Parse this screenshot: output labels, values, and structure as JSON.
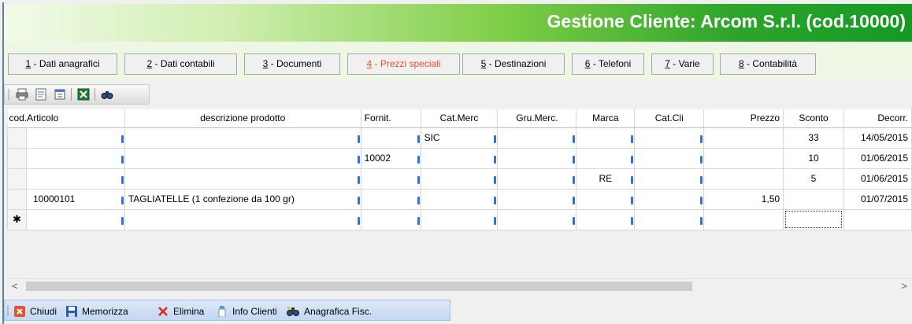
{
  "header": {
    "title": "Gestione Cliente: Arcom S.r.l. (cod.10000)"
  },
  "tabs": [
    {
      "num": "1",
      "label": " - Dati anagrafici"
    },
    {
      "num": "2",
      "label": " - Dati contabili"
    },
    {
      "num": "3",
      "label": " - Documenti"
    },
    {
      "num": "4",
      "label": " - Prezzi speciali"
    },
    {
      "num": "5",
      "label": " - Destinazioni"
    },
    {
      "num": "6",
      "label": " - Telefoni"
    },
    {
      "num": "7",
      "label": " - Varie"
    },
    {
      "num": "8",
      "label": " - Contabilità"
    }
  ],
  "toolbar": {
    "icons": [
      "print-icon",
      "print-preview-icon",
      "page-setup-icon",
      "excel-export-icon",
      "find-icon"
    ]
  },
  "grid": {
    "columns": [
      "cod.Articolo",
      "descrizione prodotto",
      "Fornit.",
      "Cat.Merc",
      "Gru.Merc.",
      "Marca",
      "Cat.Cli",
      "Prezzo",
      "Sconto",
      "Decorr."
    ],
    "rows": [
      [
        "",
        "",
        "",
        "SIC",
        "",
        "",
        "",
        "",
        "33",
        "14/05/2015"
      ],
      [
        "",
        "",
        "10002",
        "",
        "",
        "",
        "",
        "",
        "10",
        "01/06/2015"
      ],
      [
        "",
        "",
        "",
        "",
        "",
        "RE",
        "",
        "",
        "5",
        "01/06/2015"
      ],
      [
        "10000101",
        "TAGLIATELLE (1 confezione da 100 gr)",
        "",
        "",
        "",
        "",
        "",
        "1,50",
        "",
        "01/07/2015"
      ]
    ],
    "new_row_marker": "✱"
  },
  "statusbar": {
    "chiudi": "Chiudi",
    "memorizza": "Memorizza",
    "elimina": "Elimina",
    "info_clienti": "Info Clienti",
    "anagrafica": "Anagrafica Fisc."
  },
  "colors": {
    "active_tab": "#e8502d",
    "header_green": "#139a23",
    "statusbar": "#c5d8f0"
  }
}
